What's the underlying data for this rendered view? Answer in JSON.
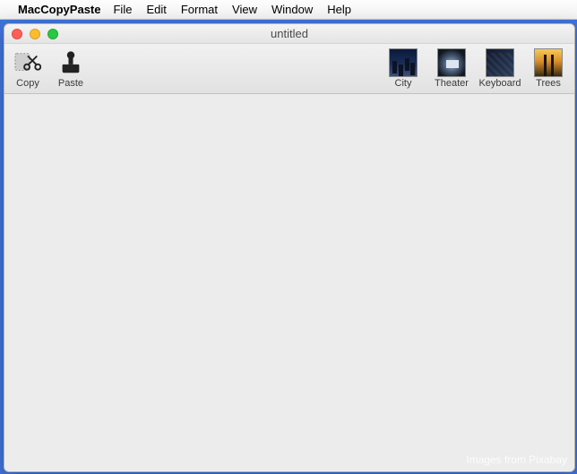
{
  "menubar": {
    "app_name": "MacCopyPaste",
    "items": [
      "File",
      "Edit",
      "Format",
      "View",
      "Window",
      "Help"
    ]
  },
  "window": {
    "title": "untitled"
  },
  "toolbar": {
    "left": [
      {
        "name": "copy",
        "label": "Copy"
      },
      {
        "name": "paste",
        "label": "Paste"
      }
    ],
    "right": [
      {
        "name": "city",
        "label": "City"
      },
      {
        "name": "theater",
        "label": "Theater"
      },
      {
        "name": "keyboard",
        "label": "Keyboard"
      },
      {
        "name": "trees",
        "label": "Trees"
      }
    ]
  },
  "content": {
    "credit": "Images from Pixabay"
  }
}
